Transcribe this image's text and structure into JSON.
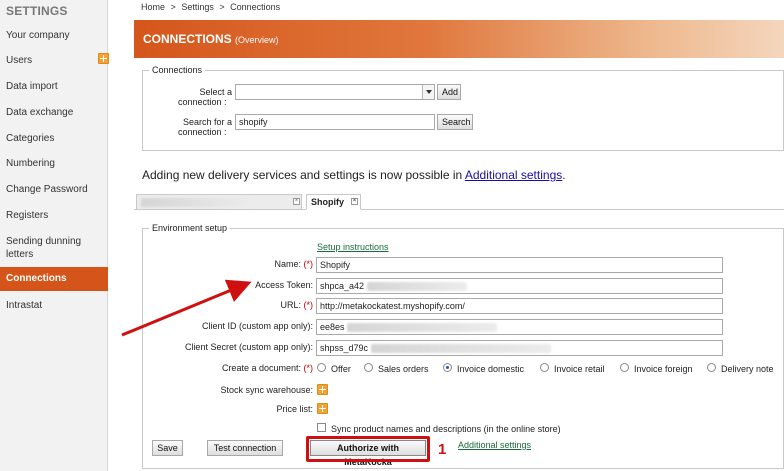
{
  "sidebar": {
    "title": "SETTINGS",
    "items": [
      {
        "label": "Your company"
      },
      {
        "label": "Users"
      },
      {
        "label": "Data import"
      },
      {
        "label": "Data exchange"
      },
      {
        "label": "Categories"
      },
      {
        "label": "Numbering"
      },
      {
        "label": "Change Password"
      },
      {
        "label": "Registers"
      },
      {
        "label": "Sending dunning letters"
      },
      {
        "label": "Connections"
      },
      {
        "label": "Intrastat"
      }
    ]
  },
  "breadcrumb": {
    "home": "Home",
    "sep": ">",
    "settings": "Settings",
    "current": "Connections"
  },
  "banner": {
    "title": "CONNECTIONS",
    "subtitle": "(Overview)"
  },
  "connections": {
    "legend": "Connections",
    "select_label_1": "Select a",
    "select_label_2": "connection :",
    "select_value": "",
    "add_label": "Add",
    "search_label_1": "Search for a",
    "search_label_2": "connection :",
    "search_value": "shopify",
    "search_button": "Search"
  },
  "info": {
    "text": "Adding new delivery services and settings is now possible in ",
    "link": "Additional settings",
    "end": "."
  },
  "tabs": {
    "second_label": "Shopify",
    "close_glyph": "×"
  },
  "env": {
    "legend": "Environment setup",
    "setup_link": "Setup instructions",
    "name_label": "Name:",
    "required_mark": "(*)",
    "name_value": "Shopify",
    "token_label": "Access Token:",
    "token_value": "shpca_a42",
    "url_label": "URL:",
    "url_value": "http://metakockatest.myshopify.com/",
    "client_id_label": "Client ID (custom app only):",
    "client_id_value": "ee8es",
    "client_secret_label": "Client Secret (custom app only):",
    "client_secret_value": "shpss_d79c",
    "create_doc_label": "Create a document:",
    "doc_options": [
      {
        "label": "Offer",
        "checked": false
      },
      {
        "label": "Sales orders",
        "checked": false
      },
      {
        "label": "Invoice domestic",
        "checked": true
      },
      {
        "label": "Invoice retail",
        "checked": false
      },
      {
        "label": "Invoice foreign",
        "checked": false
      },
      {
        "label": "Delivery note",
        "checked": false
      }
    ],
    "stock_sync_label": "Stock sync warehouse:",
    "price_list_label": "Price list:",
    "sync_checkbox_label": "Sync product names and descriptions (in the online store)",
    "sync_checked": false
  },
  "actions": {
    "save": "Save",
    "test": "Test connection",
    "authorize": "Authorize with MetaKocka",
    "additional": "Additional settings"
  },
  "annotation": {
    "number": "1",
    "color": "#d01010"
  },
  "colors": {
    "accent": "#d4541a",
    "link": "#1a0dab",
    "setup_link": "#1a6b3a"
  }
}
